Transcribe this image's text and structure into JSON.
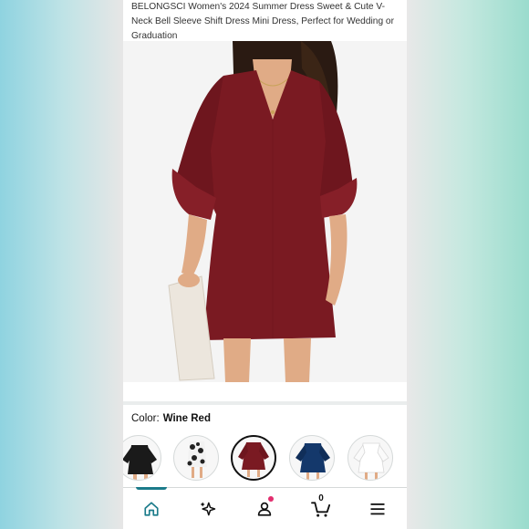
{
  "product": {
    "title": "BELONGSCI Women's 2024 Summer Dress Sweet & Cute V-Neck Bell Sleeve Shift Dress Mini Dress, Perfect for Wedding or Graduation",
    "title_partially_visible": true
  },
  "variants": {
    "label": "Color:",
    "selected": "Wine Red",
    "options": [
      {
        "color": "black",
        "hex": "#1a1a1a"
      },
      {
        "color": "floral",
        "hex": "#2a2a2a"
      },
      {
        "color": "wine red",
        "hex": "#7a1a22",
        "selected": true
      },
      {
        "color": "navy blue",
        "hex": "#14386b"
      },
      {
        "color": "white",
        "hex": "#f4f4f4"
      }
    ]
  },
  "bottom_nav": {
    "items": [
      {
        "name": "home",
        "icon": "home-icon",
        "active": true
      },
      {
        "name": "for-you",
        "icon": "sparkle-icon"
      },
      {
        "name": "account",
        "icon": "person-icon",
        "has_badge": true
      },
      {
        "name": "cart",
        "icon": "cart-icon",
        "count": "0"
      },
      {
        "name": "menu",
        "icon": "hamburger-icon"
      }
    ]
  },
  "colors": {
    "accent": "#1b7b8a",
    "badge": "#e22e6e",
    "dress": "#7a1a22"
  }
}
